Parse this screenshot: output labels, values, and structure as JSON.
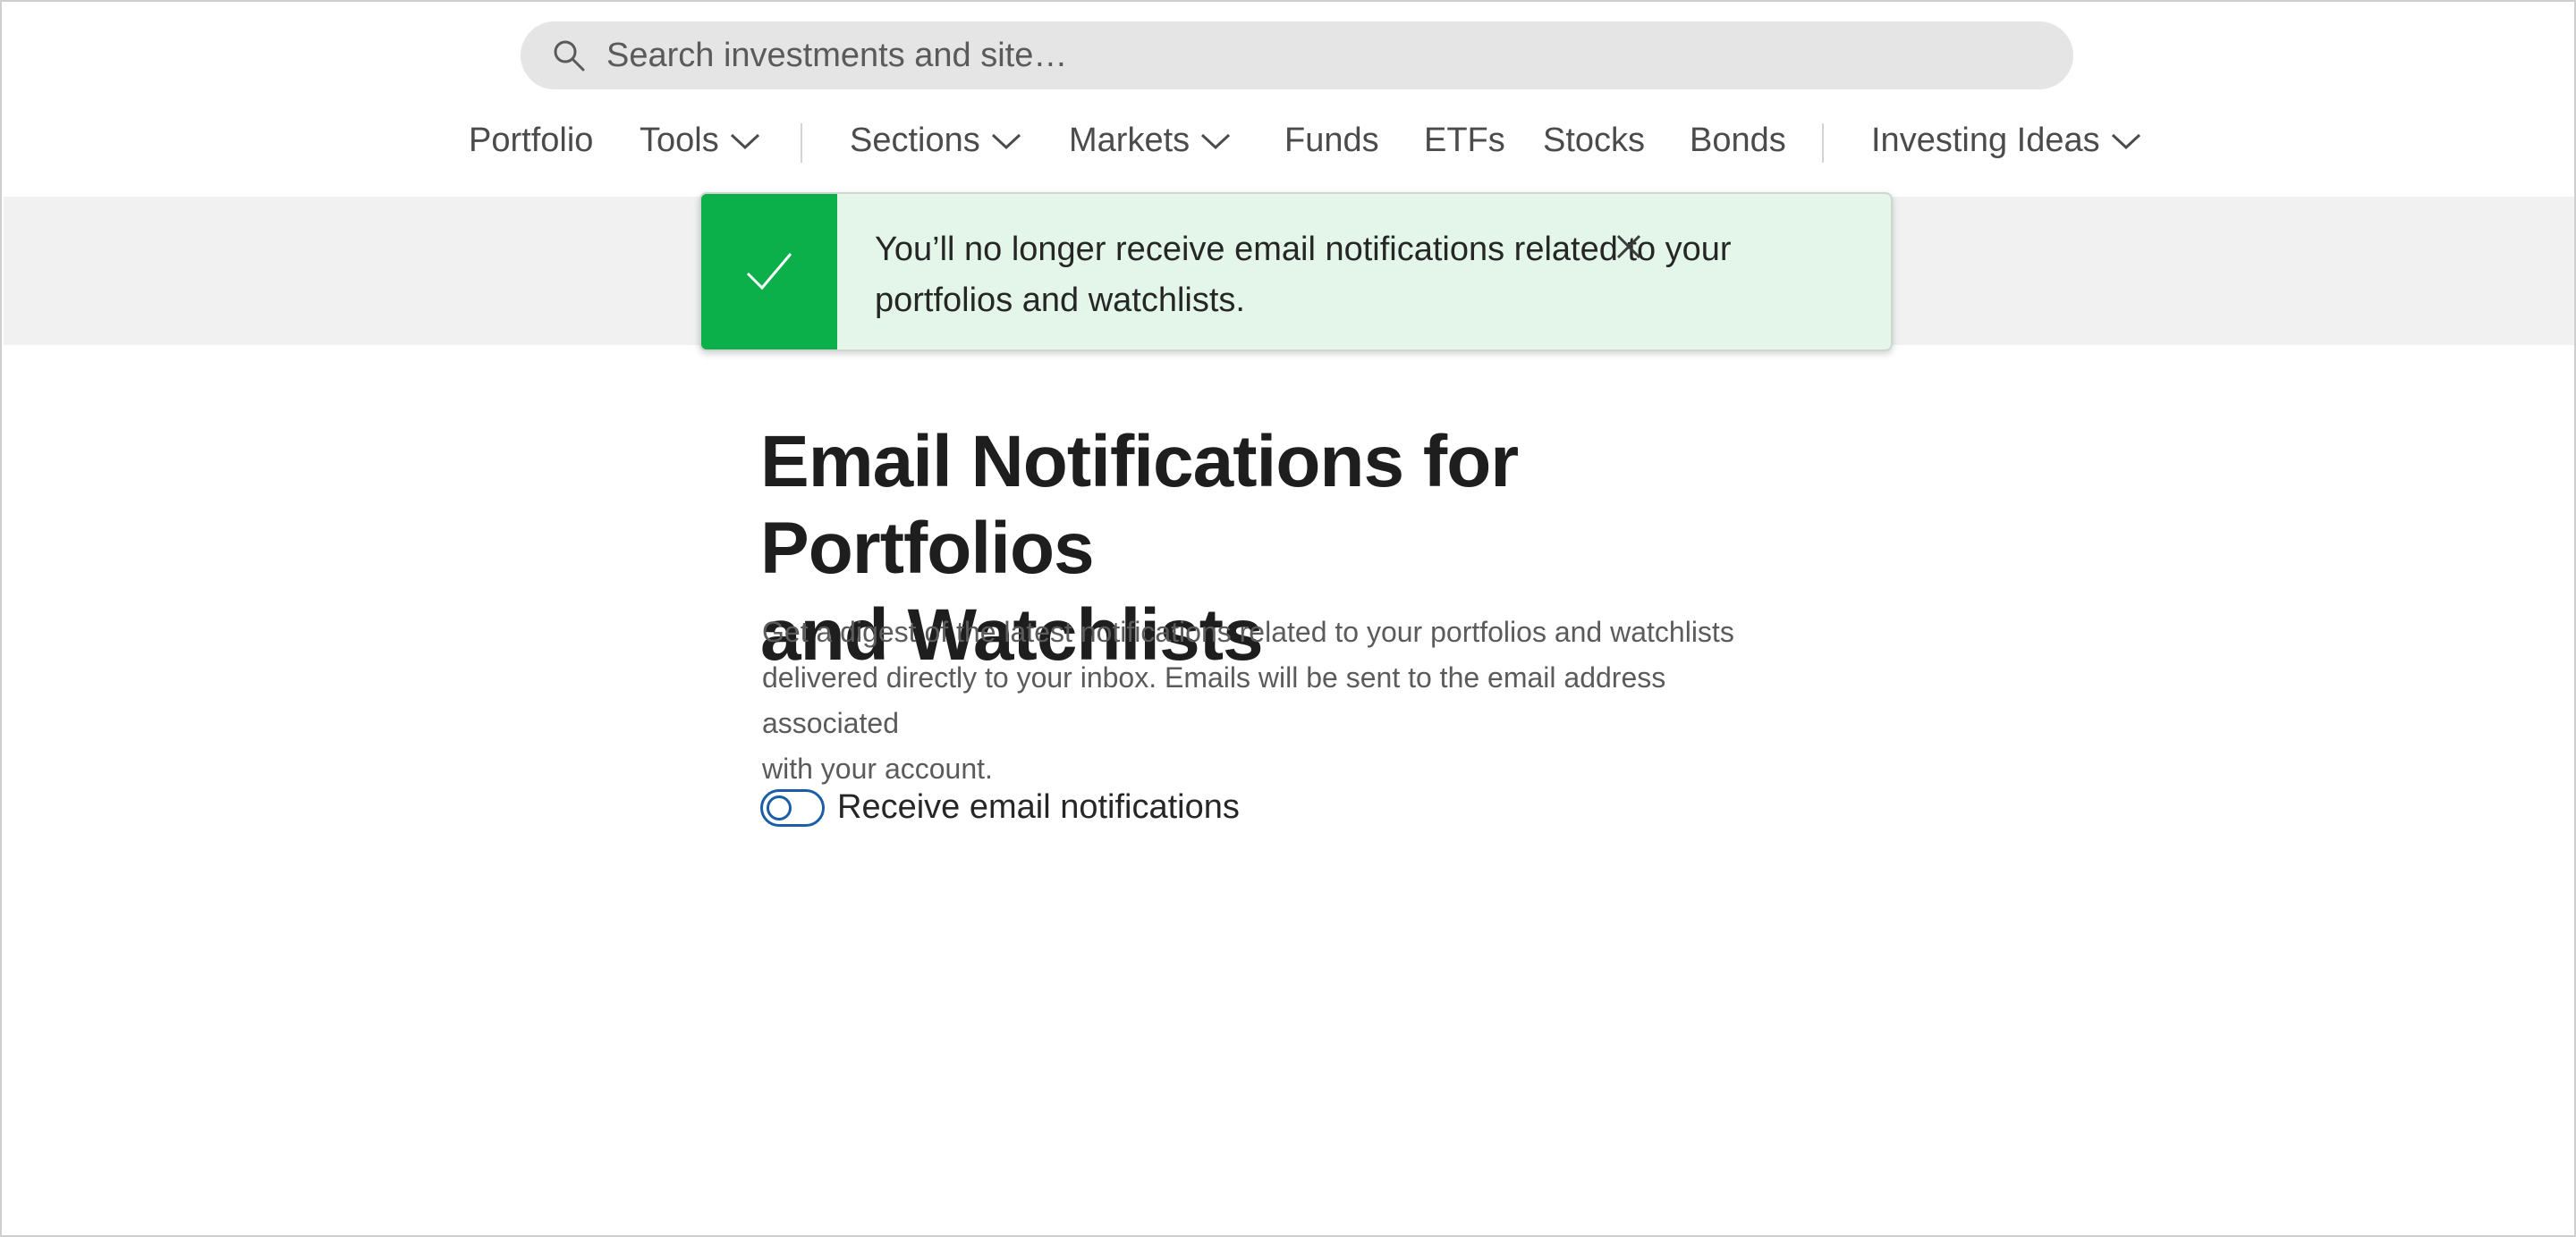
{
  "search": {
    "placeholder": "Search investments and site…"
  },
  "nav": {
    "items": [
      {
        "label": "Portfolio",
        "dropdown": false
      },
      {
        "label": "Tools",
        "dropdown": true
      },
      {
        "label": "Sections",
        "dropdown": true
      },
      {
        "label": "Markets",
        "dropdown": true
      },
      {
        "label": "Funds",
        "dropdown": false
      },
      {
        "label": "ETFs",
        "dropdown": false
      },
      {
        "label": "Stocks",
        "dropdown": false
      },
      {
        "label": "Bonds",
        "dropdown": false
      },
      {
        "label": "Investing Ideas",
        "dropdown": true
      }
    ]
  },
  "toast": {
    "line1": "You’ll no longer receive email notifications related to your",
    "line2": "portfolios and watchlists.",
    "status": "success",
    "accent_color": "#0bb04b",
    "icon": "check-icon"
  },
  "main": {
    "title_line1": "Email Notifications for Portfolios",
    "title_line2": "and Watchlists",
    "description_line1": "Get a digest of the latest notifications related to your portfolios and watchlists",
    "description_line2": "delivered directly to your inbox. Emails will be sent to the email address associated",
    "description_line3": "with your account.",
    "toggle_label": "Receive email notifications",
    "toggle_on": false,
    "toggle_color": "#1c5ea6"
  }
}
